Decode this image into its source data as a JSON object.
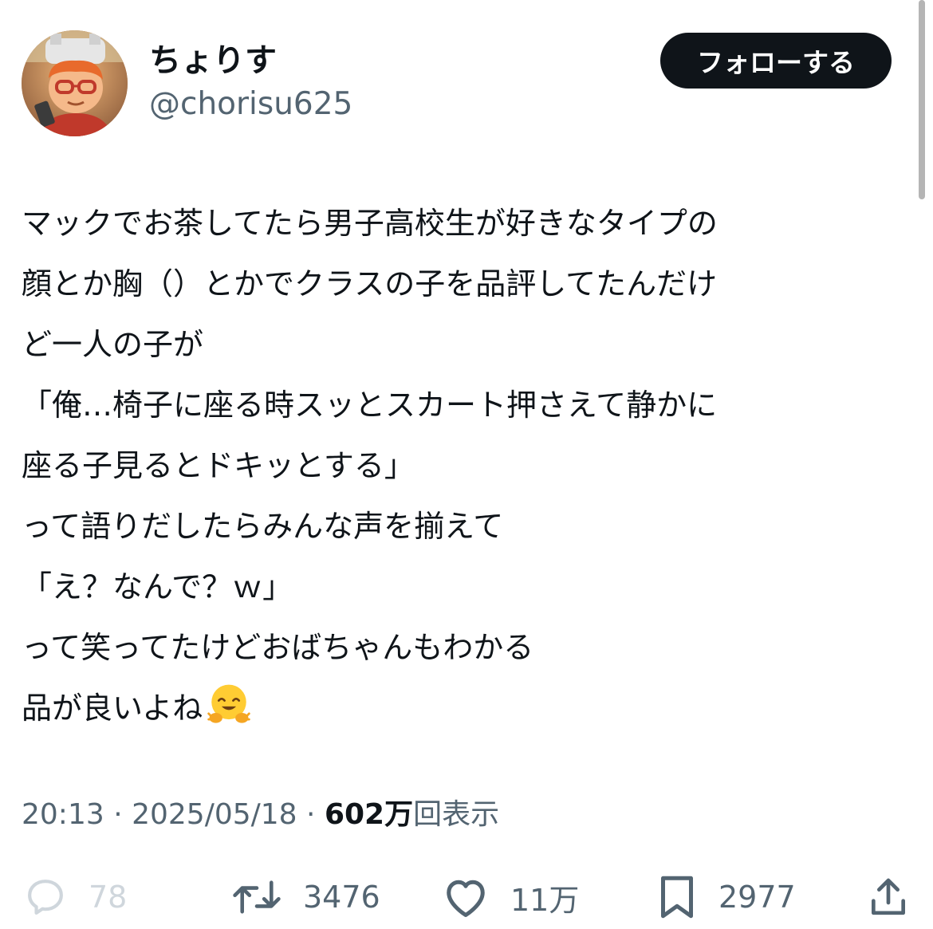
{
  "author": {
    "display_name": "ちょりす",
    "handle": "@chorisu625",
    "avatar_icon": "avatar-icon"
  },
  "follow_button": {
    "label": "フォローする"
  },
  "tweet": {
    "lines": [
      "マックでお茶してたら男子高校生が好きなタイプの",
      "顔とか胸（）とかでクラスの子を品評してたんだけ",
      "ど一人の子が",
      "「俺…椅子に座る時スッとスカート押さえて静かに",
      "座る子見るとドキッとする」",
      "って語りだしたらみんな声を揃えて",
      "「え？なんで？ｗ」",
      "って笑ってたけどおばちゃんもわかる",
      "品が良いよね"
    ],
    "emoji": "hugging-face-emoji"
  },
  "meta": {
    "time": "20:13",
    "separator": " · ",
    "date": "2025/05/18",
    "views_count": "602万",
    "views_label": "回表示"
  },
  "actions": {
    "reply": {
      "icon": "reply-icon",
      "count": "78"
    },
    "retweet": {
      "icon": "retweet-icon",
      "count": "3476"
    },
    "like": {
      "icon": "heart-icon",
      "count": "11万"
    },
    "bookmark": {
      "icon": "bookmark-icon",
      "count": "2977"
    },
    "share": {
      "icon": "share-icon"
    }
  },
  "colors": {
    "text": "#0f1419",
    "secondary": "#536471",
    "button_bg": "#0f1419",
    "button_text": "#ffffff",
    "disabled": "#cfd6dc"
  }
}
